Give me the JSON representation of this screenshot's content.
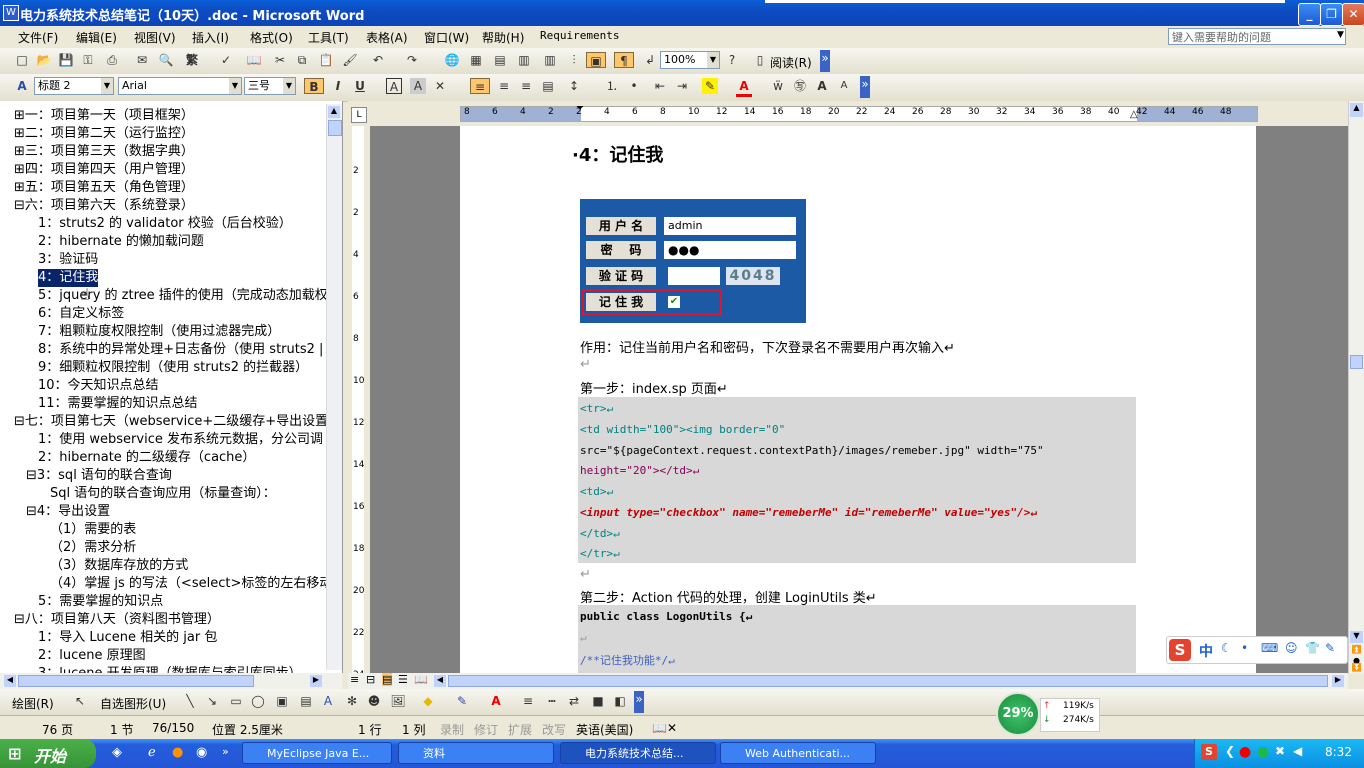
{
  "window": {
    "title": "电力系统技术总结笔记（10天）.doc - Microsoft Word",
    "min_label": "_",
    "max_label": "❐",
    "close_label": "✕"
  },
  "menu": {
    "items": [
      "文件(F)",
      "编辑(E)",
      "视图(V)",
      "插入(I)",
      "格式(O)",
      "工具(T)",
      "表格(A)",
      "窗口(W)",
      "帮助(H)",
      "Requirements"
    ],
    "help_placeholder": "键入需要帮助的问题"
  },
  "toolbar1": {
    "zoom": "100%",
    "reading": "阅读(R)",
    "trad_char": "繁"
  },
  "toolbar2": {
    "style": "标题 2",
    "font": "Arial",
    "size": "三号",
    "bold": "B",
    "italic": "I",
    "underline": "U"
  },
  "nav": {
    "items": [
      {
        "label": "⊞一：项目第一天（项目框架）"
      },
      {
        "label": "⊞二：项目第二天（运行监控）"
      },
      {
        "label": "⊞三：项目第三天（数据字典）"
      },
      {
        "label": "⊞四：项目第四天（用户管理）"
      },
      {
        "label": "⊞五：项目第五天（角色管理）"
      },
      {
        "label": "⊟六：项目第六天（系统登录）"
      },
      {
        "label": "1：struts2 的 validator 校验（后台校验）"
      },
      {
        "label": "2：hibernate 的懒加载问题"
      },
      {
        "label": "3：验证码"
      },
      {
        "label": "4：记住我"
      },
      {
        "label": "5：jquery 的 ztree 插件的使用（完成动态加载权"
      },
      {
        "label": "6：自定义标签"
      },
      {
        "label": "7：粗颗粒度权限控制（使用过滤器完成）"
      },
      {
        "label": "8：系统中的异常处理+日志备份（使用 struts2 |"
      },
      {
        "label": "9：细颗粒权限控制（使用 struts2 的拦截器）"
      },
      {
        "label": "10：今天知识点总结"
      },
      {
        "label": "11：需要掌握的知识点总结"
      },
      {
        "label": "⊟七：项目第七天（webservice+二级缓存+导出设置"
      },
      {
        "label": "1：使用 webservice 发布系统元数据，分公司调"
      },
      {
        "label": "2：hibernate 的二级缓存（cache）"
      },
      {
        "label": "⊟3：sql 语句的联合查询"
      },
      {
        "label": "Sql 语句的联合查询应用（标量查询）："
      },
      {
        "label": "⊟4：导出设置"
      },
      {
        "label": "（1）需要的表"
      },
      {
        "label": "（2）需求分析"
      },
      {
        "label": "（3）数据库存放的方式"
      },
      {
        "label": "（4）掌握 js 的写法（<select>标签的左右移动"
      },
      {
        "label": "5：需要掌握的知识点"
      },
      {
        "label": "⊟八：项目第八天（资料图书管理）"
      },
      {
        "label": "1：导入 Lucene 相关的 jar 包"
      },
      {
        "label": "2：lucene 原理图"
      },
      {
        "label": "3：lucene 开发原理（数据库与索引库同步）"
      }
    ]
  },
  "ruler": {
    "ticks": [
      "8",
      "6",
      "4",
      "2",
      "2",
      "4",
      "6",
      "8",
      "10",
      "12",
      "14",
      "16",
      "18",
      "20",
      "22",
      "24",
      "26",
      "28",
      "30",
      "32",
      "34",
      "36",
      "38",
      "40",
      "42",
      "44",
      "46",
      "48"
    ]
  },
  "vruler": {
    "ticks": [
      "2",
      "2",
      "4",
      "6",
      "8",
      "10",
      "12",
      "14",
      "16",
      "18",
      "20",
      "22",
      "24"
    ]
  },
  "doc": {
    "heading": "·4：记住我",
    "login": {
      "user_label": "用 户 名",
      "user_value": "admin",
      "pwd_label": "密    码",
      "pwd_value": "●●●",
      "captcha_label": "验 证 码",
      "captcha_value": "4048",
      "remember_label": "记 住 我",
      "remember_checked": "✔"
    },
    "desc": "作用：记住当前用户名和密码，下次登录名不需要用户再次输入↵",
    "step1": "第一步：index.sp 页面↵",
    "code1": [
      "<tr>↵",
      "    <td width=\"100\"><img border=\"0\"",
      "src=\"${pageContext.request.contextPath}/images/remeber.jpg\" width=\"75\"",
      "height=\"20\"></td>↵",
      "    <td>↵",
      "        <input type=\"checkbox\" name=\"remeberMe\" id=\"remeberMe\" value=\"yes\"/>↵",
      "    </td>↵",
      "</tr>↵"
    ],
    "step2": "第二步：Action 代码的处理，创建 LoginUtils 类↵",
    "code2": [
      "public class LogonUtils {↵",
      "↵",
      "    /**记住我功能*/↵"
    ]
  },
  "drawbar": {
    "draw": "绘图(R)",
    "autoshapes": "自选图形(U)"
  },
  "status": {
    "page": "76 页",
    "section": "1 节",
    "pages": "76/150",
    "position": "位置 2.5厘米",
    "line": "1 行",
    "col": "1 列",
    "rec": "录制",
    "trk": "修订",
    "ext": "扩展",
    "ovr": "改写",
    "lang": "英语(美国)"
  },
  "netmeter": {
    "percent": "29%",
    "up": "119K/s",
    "down": "274K/s"
  },
  "ime": {
    "label": "中"
  },
  "taskbar": {
    "start": "开始",
    "tasks": [
      "MyEclipse Java E...",
      "资料",
      "电力系统技术总结...",
      "Web Authenticati..."
    ],
    "clock": "8:32"
  }
}
